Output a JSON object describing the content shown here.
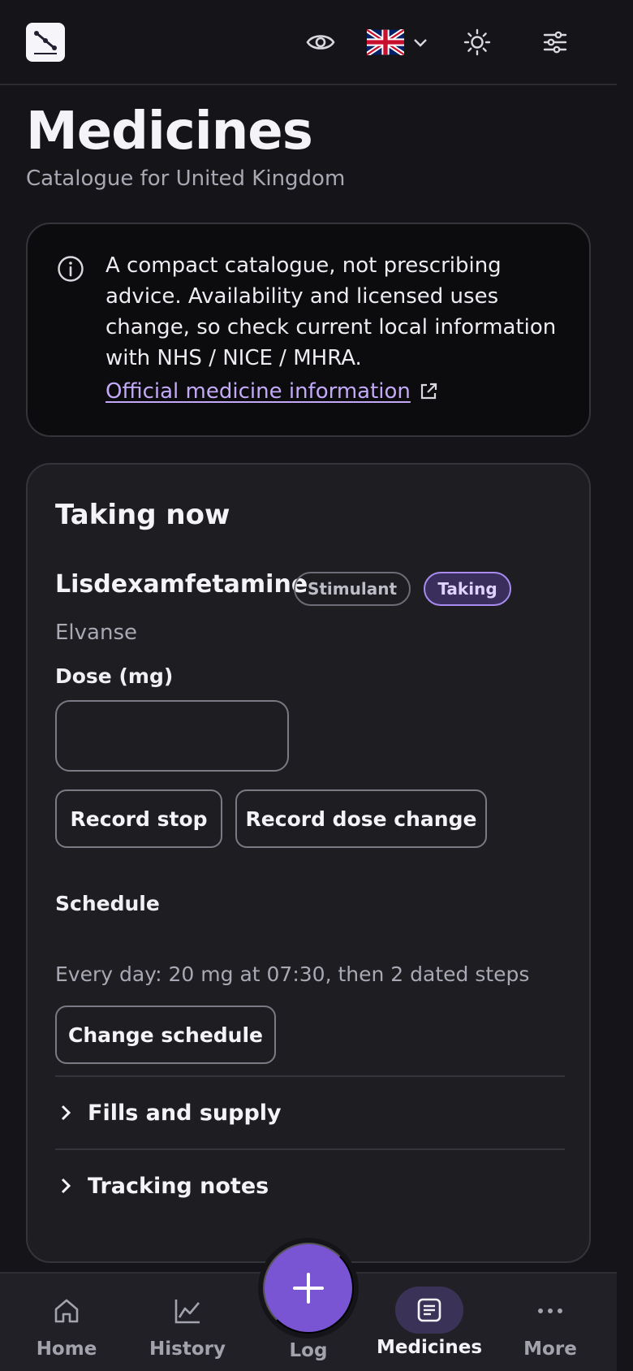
{
  "header": {
    "logo_icon": "trend-down-chart-logo",
    "privacy_icon": "eye-icon",
    "language_flag": "united-kingdom-flag-icon",
    "theme_icon": "sun-icon",
    "settings_icon": "sliders-icon"
  },
  "page": {
    "title": "Medicines",
    "subtitle": "Catalogue for United Kingdom"
  },
  "notice": {
    "text": "A compact catalogue, not prescribing advice. Availability and licensed uses change, so check current local information with NHS / NICE / MHRA.",
    "link_label": "Official medicine information"
  },
  "taking_now": {
    "section_title": "Taking now",
    "medicine": {
      "name": "Lisdexamfetamine",
      "class_badge": "Stimulant",
      "status_badge": "Taking",
      "brand": "Elvanse"
    },
    "dose_label": "Dose (mg)",
    "dose_value": "",
    "record_stop_label": "Record stop",
    "record_dose_change_label": "Record dose change",
    "schedule_label": "Schedule",
    "schedule_summary": "Every day: 20 mg at 07:30, then 2 dated steps",
    "change_schedule_label": "Change schedule",
    "disclosures": [
      {
        "label": "Fills and supply"
      },
      {
        "label": "Tracking notes"
      }
    ]
  },
  "bottom_nav": {
    "items": [
      {
        "label": "Home",
        "icon": "home-icon"
      },
      {
        "label": "History",
        "icon": "chart-line-icon"
      },
      {
        "label": "Log",
        "icon": "plus-icon"
      },
      {
        "label": "Medicines",
        "icon": "document-list-icon",
        "active": true
      },
      {
        "label": "More",
        "icon": "more-dots-icon"
      }
    ]
  },
  "colors": {
    "background": "#151519",
    "card": "#1d1d22",
    "accent": "#7a55d3",
    "link": "#c3a9f7"
  }
}
